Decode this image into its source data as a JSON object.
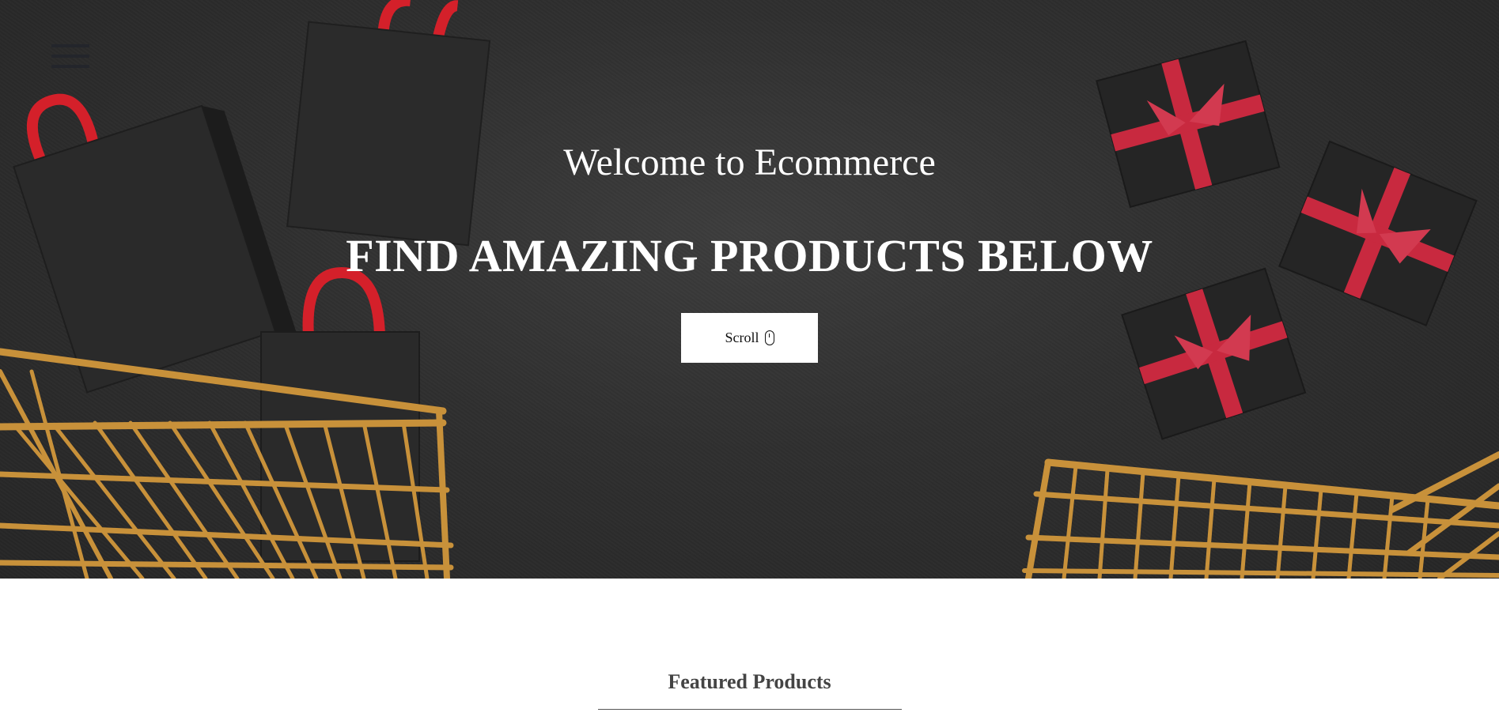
{
  "hero": {
    "welcome_text": "Welcome to Ecommerce",
    "headline": "FIND AMAZING PRODUCTS BELOW",
    "scroll_button_label": "Scroll",
    "menu_icon": "hamburger-menu-icon",
    "scroll_icon": "mouse-icon"
  },
  "featured": {
    "title": "Featured Products"
  },
  "colors": {
    "hero_background": "#2f2f2f",
    "bag_red": "#d4202a",
    "ribbon_red": "#c8293f",
    "cart_gold": "#c8913a",
    "text_white": "#ffffff",
    "menu_icon": "#23252b"
  }
}
